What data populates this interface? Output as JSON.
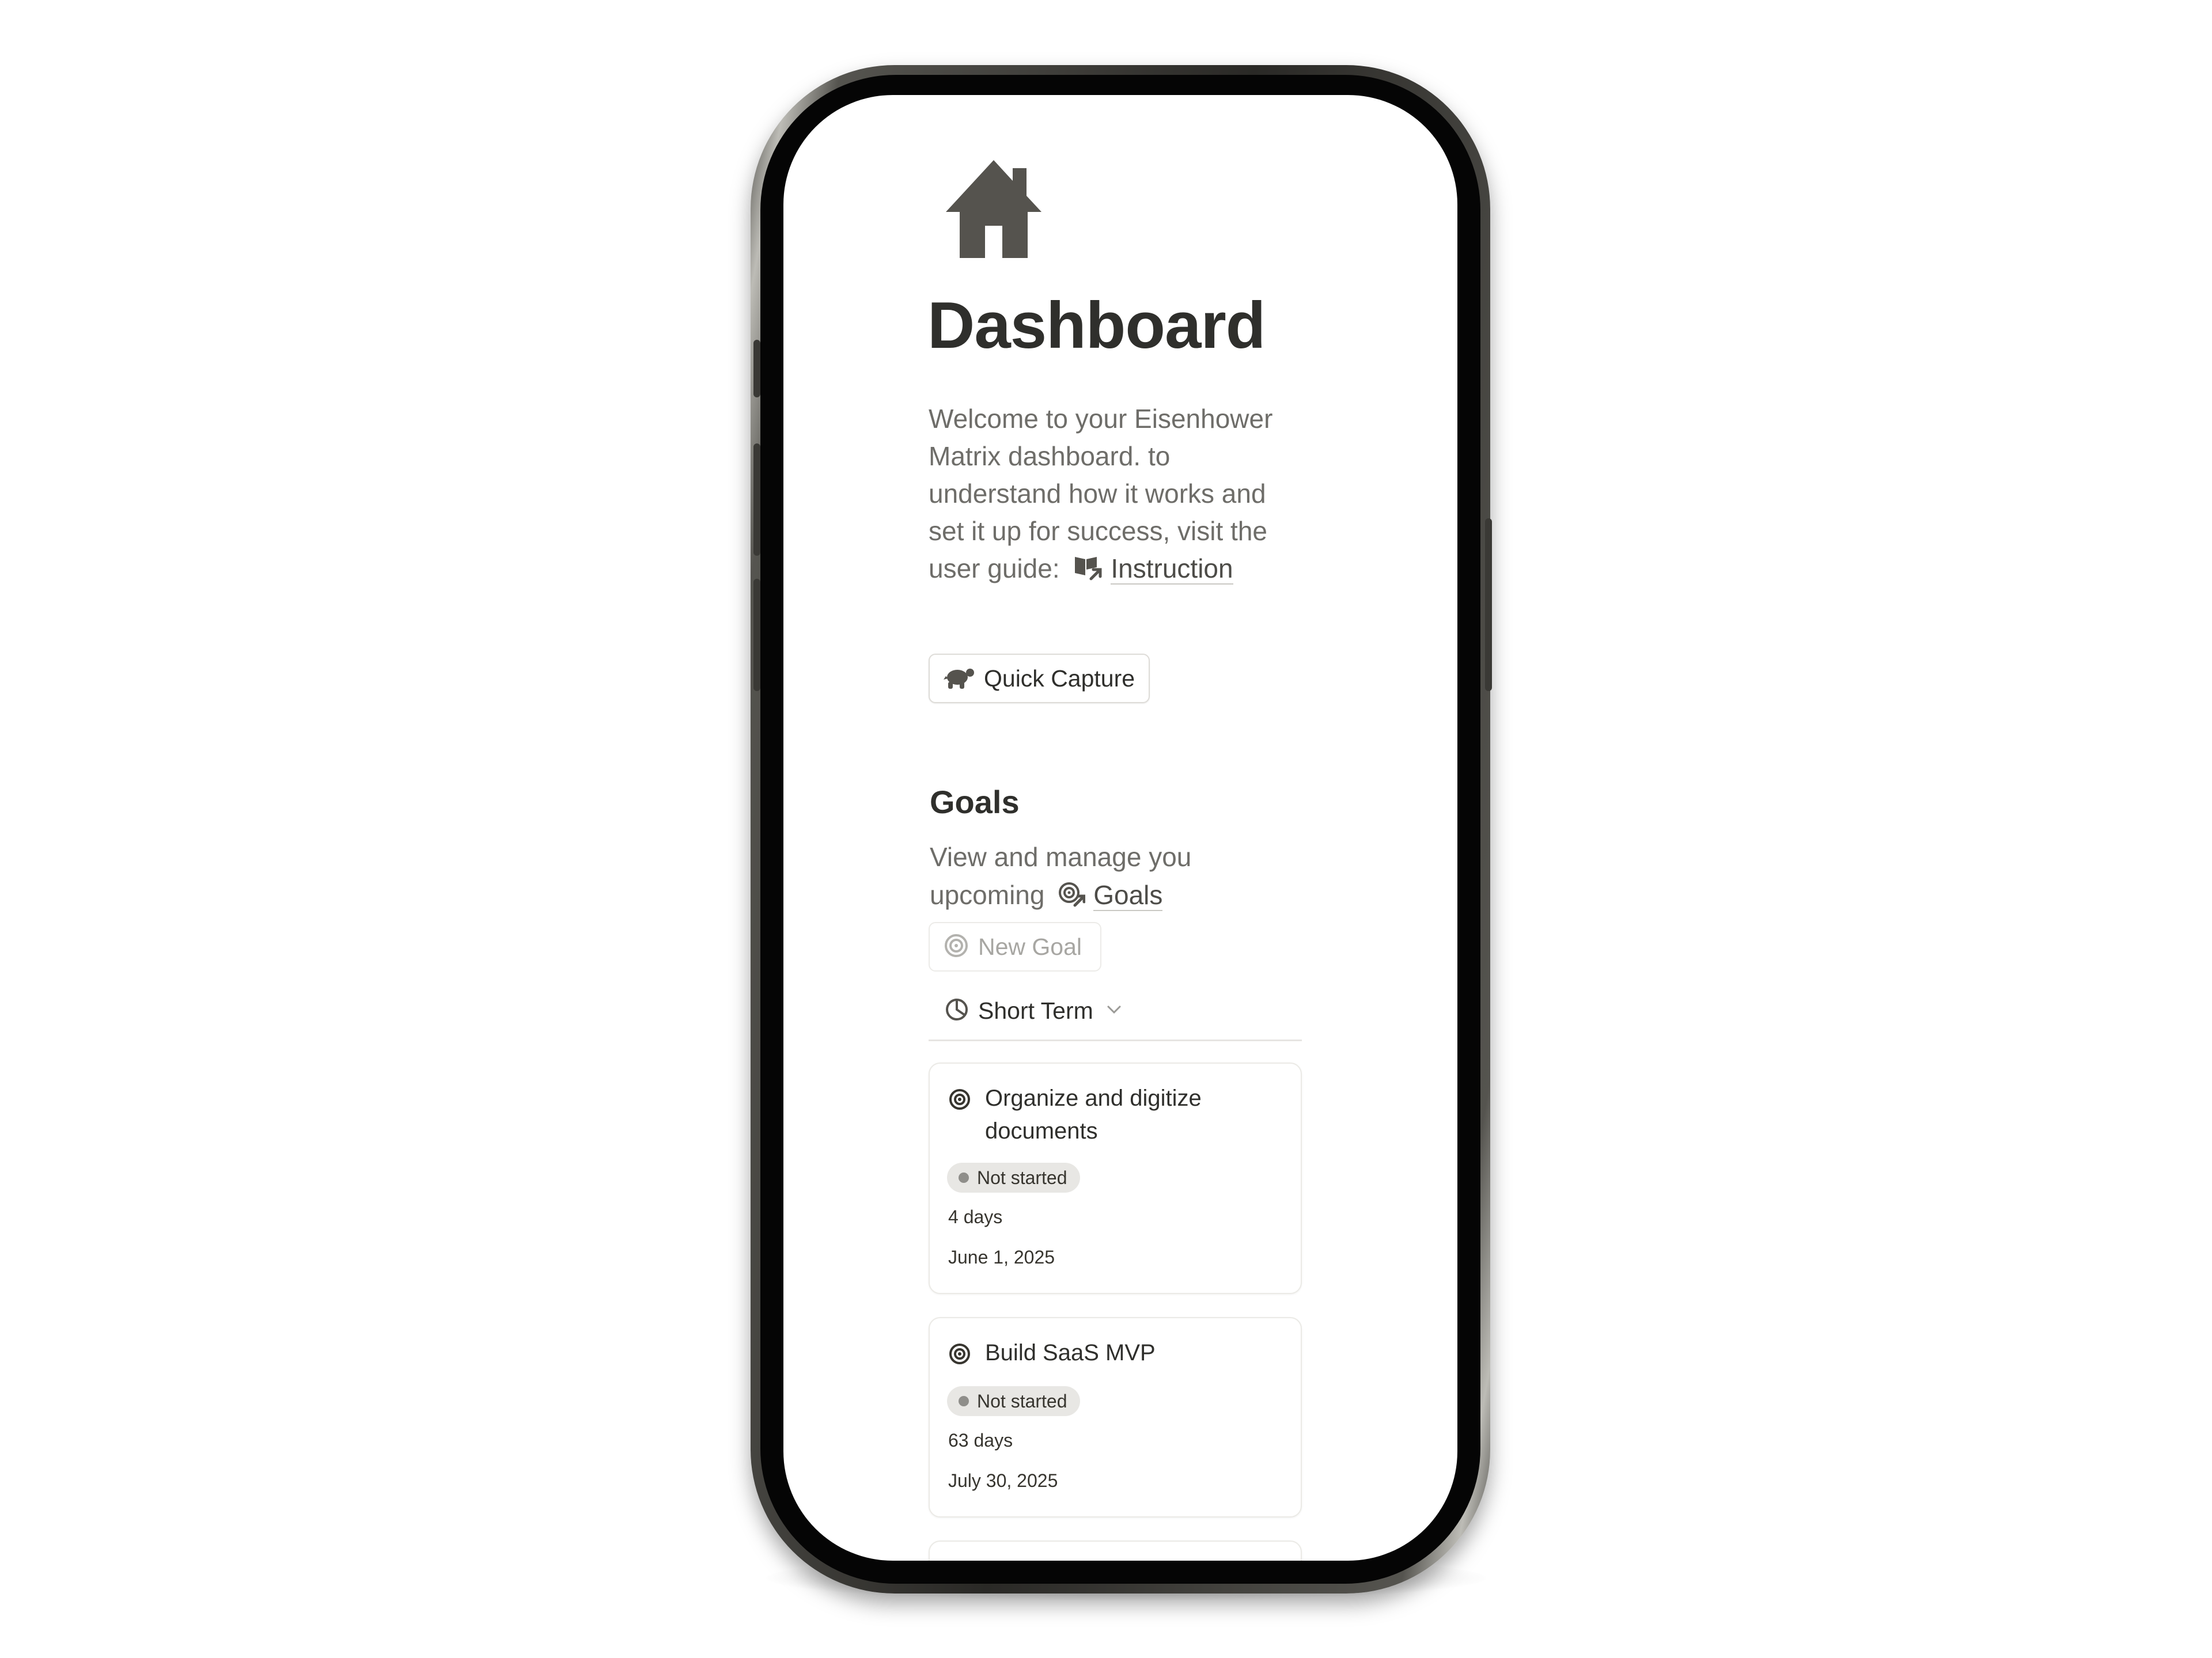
{
  "page": {
    "icon": "house-icon",
    "title": "Dashboard",
    "intro_lines": [
      "Welcome to your Eisenhower",
      "Matrix dashboard. to",
      "understand how it works and",
      "set it up for success, visit the",
      "user guide:"
    ],
    "intro_link": {
      "icon": "book-link-icon",
      "label": "Instruction"
    }
  },
  "quick_capture": {
    "icon": "turtle-icon",
    "label": "Quick Capture"
  },
  "goals": {
    "heading": "Goals",
    "description_line1": "View and manage you",
    "description_line2_prefix": "upcoming",
    "link": {
      "icon": "goal-link-icon",
      "label": "Goals"
    },
    "new_goal": {
      "icon": "target-icon",
      "label": "New Goal"
    },
    "view": {
      "icon": "pie-chart-icon",
      "label": "Short Term",
      "dropdown_icon": "chevron-down-icon"
    },
    "cards": [
      {
        "icon": "target-icon",
        "title_line1": "Organize and digitize",
        "title_line2": "documents",
        "status": "Not started",
        "duration": "4 days",
        "date": "June 1, 2025"
      },
      {
        "icon": "target-icon",
        "title_line1": "Build SaaS MVP",
        "title_line2": "",
        "status": "Not started",
        "duration": "63 days",
        "date": "July 30, 2025"
      }
    ]
  },
  "colors": {
    "text_primary": "#2f2f2c",
    "text_secondary": "#6e6d69",
    "status_pill_bg": "#e8e7e4",
    "status_dot": "#8f8e8a",
    "icon_dark": "#55534e"
  }
}
